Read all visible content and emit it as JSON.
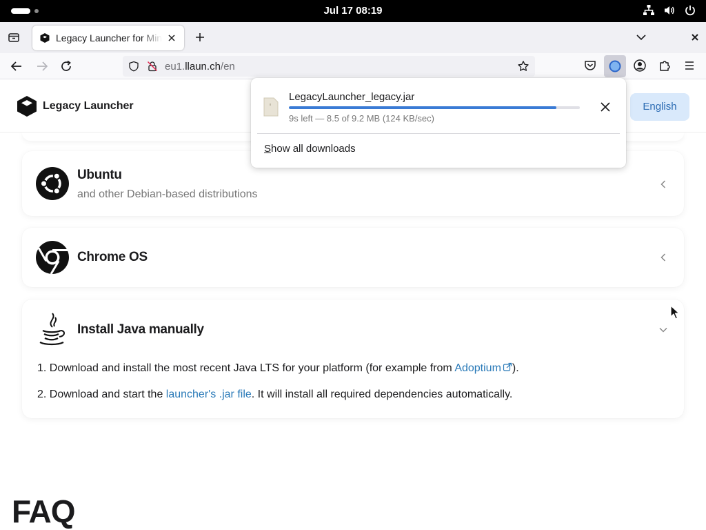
{
  "topbar": {
    "clock": "Jul 17  08:19"
  },
  "tabs": [
    {
      "title": "Legacy Launcher for Minecraft"
    }
  ],
  "urlbar": {
    "url_prefix": "eu1.",
    "url_domain": "llaun.ch",
    "url_path": "/en"
  },
  "site": {
    "brand": "Legacy Launcher",
    "language_button": "English"
  },
  "platforms": [
    {
      "title": "Ubuntu",
      "subtitle": "and other Debian-based distributions",
      "icon": "ubuntu-icon"
    },
    {
      "title": "Chrome OS",
      "icon": "chrome-icon"
    }
  ],
  "java_section": {
    "title": "Install Java manually",
    "step1_prefix": "1. Download and install the most recent Java LTS for your platform (for example from ",
    "step1_link": "Adoptium",
    "step1_suffix": ").",
    "step2_prefix": "2. Download and start the ",
    "step2_link": "launcher's .jar file",
    "step2_suffix": ". It will install all required dependencies automatically."
  },
  "faq_heading": "FAQ",
  "downloads": {
    "filename": "LegacyLauncher_legacy.jar",
    "progress": 0.92,
    "status": "9s left — 8.5 of 9.2 MB (124 KB/sec)",
    "show_all_first_letter": "S",
    "show_all_rest": "how all downloads"
  },
  "colors": {
    "accent": "#3a7bd5",
    "link": "#2a7ab8",
    "language_button_bg": "#d9e9fb"
  }
}
